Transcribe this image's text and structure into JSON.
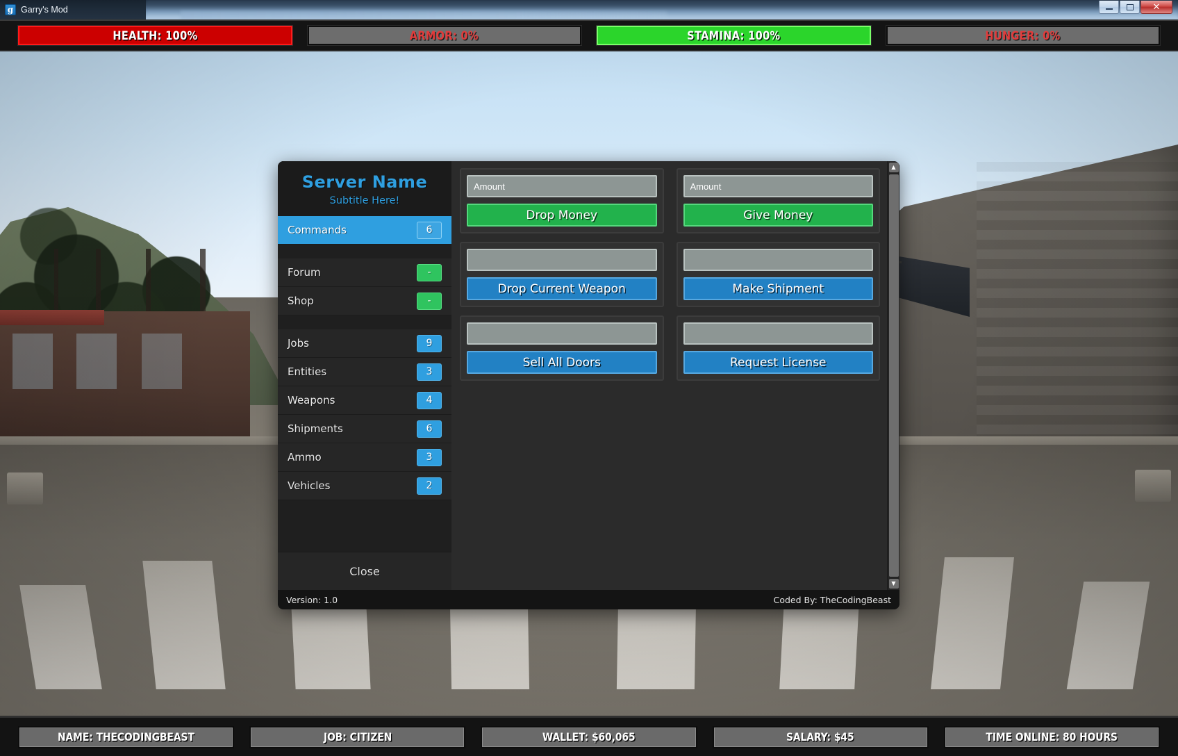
{
  "window": {
    "title": "Garry's Mod",
    "icon": "gmod-logo-icon",
    "minimize_label": "",
    "maximize_label": "",
    "close_label": "✕"
  },
  "hud_top": [
    {
      "name": "health",
      "label": "HEALTH: 100%",
      "value": 100,
      "state": "full-red",
      "text_style": "lbl-white"
    },
    {
      "name": "armor",
      "label": "ARMOR: 0%",
      "value": 0,
      "state": "empty",
      "text_style": "lbl-red"
    },
    {
      "name": "stamina",
      "label": "STAMINA: 100%",
      "value": 100,
      "state": "full-green",
      "text_style": "lbl-white"
    },
    {
      "name": "hunger",
      "label": "HUNGER: 0%",
      "value": 0,
      "state": "empty",
      "text_style": "lbl-red"
    }
  ],
  "hud_bottom": [
    {
      "name": "name",
      "label": "NAME: THECODINGBEAST"
    },
    {
      "name": "job",
      "label": "JOB: CITIZEN"
    },
    {
      "name": "wallet",
      "label": "WALLET: $60,065"
    },
    {
      "name": "salary",
      "label": "SALARY: $45"
    },
    {
      "name": "time-online",
      "label": "TIME ONLINE: 80 HOURS"
    }
  ],
  "menu": {
    "brand": {
      "title": "Server Name",
      "subtitle": "Subtitle Here!"
    },
    "nav": [
      {
        "label": "Commands",
        "badge": "6",
        "badge_style": "badge-ghost",
        "active": true,
        "gap_after": true
      },
      {
        "label": "Forum",
        "badge": "-",
        "badge_style": "badge-green",
        "active": false,
        "gap_after": false
      },
      {
        "label": "Shop",
        "badge": "-",
        "badge_style": "badge-green",
        "active": false,
        "gap_after": true
      },
      {
        "label": "Jobs",
        "badge": "9",
        "badge_style": "badge-blue",
        "active": false,
        "gap_after": false
      },
      {
        "label": "Entities",
        "badge": "3",
        "badge_style": "badge-blue",
        "active": false,
        "gap_after": false
      },
      {
        "label": "Weapons",
        "badge": "4",
        "badge_style": "badge-blue",
        "active": false,
        "gap_after": false
      },
      {
        "label": "Shipments",
        "badge": "6",
        "badge_style": "badge-blue",
        "active": false,
        "gap_after": false
      },
      {
        "label": "Ammo",
        "badge": "3",
        "badge_style": "badge-blue",
        "active": false,
        "gap_after": false
      },
      {
        "label": "Vehicles",
        "badge": "2",
        "badge_style": "badge-blue",
        "active": false,
        "gap_after": false
      }
    ],
    "close_label": "Close",
    "commands": [
      {
        "name": "drop-money",
        "placeholder": "Amount",
        "value": "",
        "button": "Drop Money",
        "button_style": "btn-green"
      },
      {
        "name": "give-money",
        "placeholder": "Amount",
        "value": "",
        "button": "Give Money",
        "button_style": "btn-green"
      },
      {
        "name": "drop-current-weapon",
        "placeholder": "",
        "value": "",
        "button": "Drop Current Weapon",
        "button_style": "btn-blue"
      },
      {
        "name": "make-shipment",
        "placeholder": "",
        "value": "",
        "button": "Make Shipment",
        "button_style": "btn-blue"
      },
      {
        "name": "sell-all-doors",
        "placeholder": "",
        "value": "",
        "button": "Sell All Doors",
        "button_style": "btn-blue"
      },
      {
        "name": "request-license",
        "placeholder": "",
        "value": "",
        "button": "Request License",
        "button_style": "btn-blue"
      }
    ],
    "scrollbar": {
      "up_arrow": "▲",
      "down_arrow": "▼"
    },
    "footer": {
      "version": "Version: 1.0",
      "credit": "Coded By: TheCodingBeast"
    }
  },
  "colors": {
    "accent_blue": "#2f9fe0",
    "accent_green": "#22b24c",
    "health_red": "#cc0000",
    "stamina_green": "#2bd52b",
    "hud_empty_gray": "#6d6d6d",
    "panel_bg": "#2b2b2b",
    "sidebar_bg": "#1f1f1f"
  }
}
